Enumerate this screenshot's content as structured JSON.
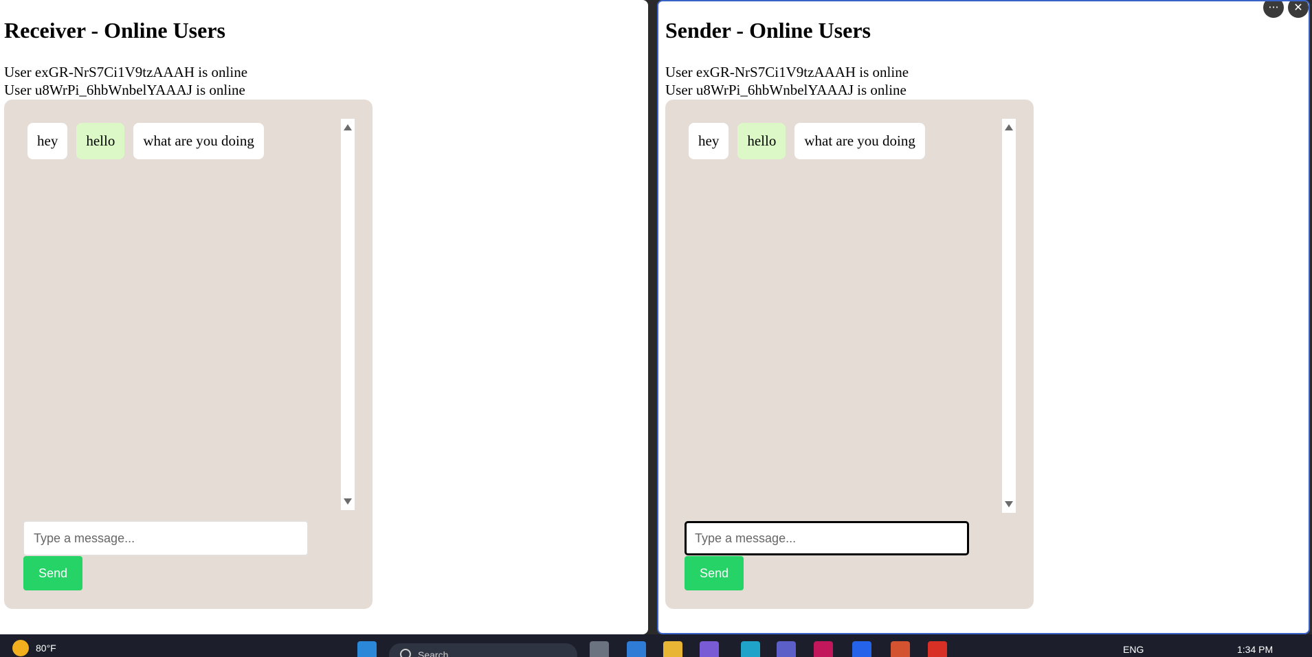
{
  "receiver": {
    "title": "Receiver - Online Users",
    "online_users": [
      "User exGR-NrS7Ci1V9tzAAAH is online",
      "User u8WrPi_6hbWnbelYAAAJ is online"
    ],
    "messages": [
      {
        "text": "hey",
        "style": "received"
      },
      {
        "text": "hello",
        "style": "sent"
      },
      {
        "text": "what are you doing",
        "style": "received"
      }
    ],
    "input_placeholder": "Type a message...",
    "send_label": "Send"
  },
  "sender": {
    "title": "Sender - Online Users",
    "online_users": [
      "User exGR-NrS7Ci1V9tzAAAH is online",
      "User u8WrPi_6hbWnbelYAAAJ is online"
    ],
    "messages": [
      {
        "text": "hey",
        "style": "received"
      },
      {
        "text": "hello",
        "style": "sent"
      },
      {
        "text": "what are you doing",
        "style": "received"
      }
    ],
    "input_placeholder": "Type a message...",
    "send_label": "Send"
  },
  "window_controls": {
    "more_glyph": "···",
    "close_glyph": "✕"
  },
  "taskbar": {
    "weather_temp": "80°F",
    "search_placeholder": "Search",
    "language": "ENG",
    "time": "1:34 PM"
  },
  "colors": {
    "chat_background": "#e5ddd5",
    "bubble_received": "#ffffff",
    "bubble_sent": "#dcf8c6",
    "send_button": "#25d366",
    "focus_border": "#3a63c9"
  }
}
